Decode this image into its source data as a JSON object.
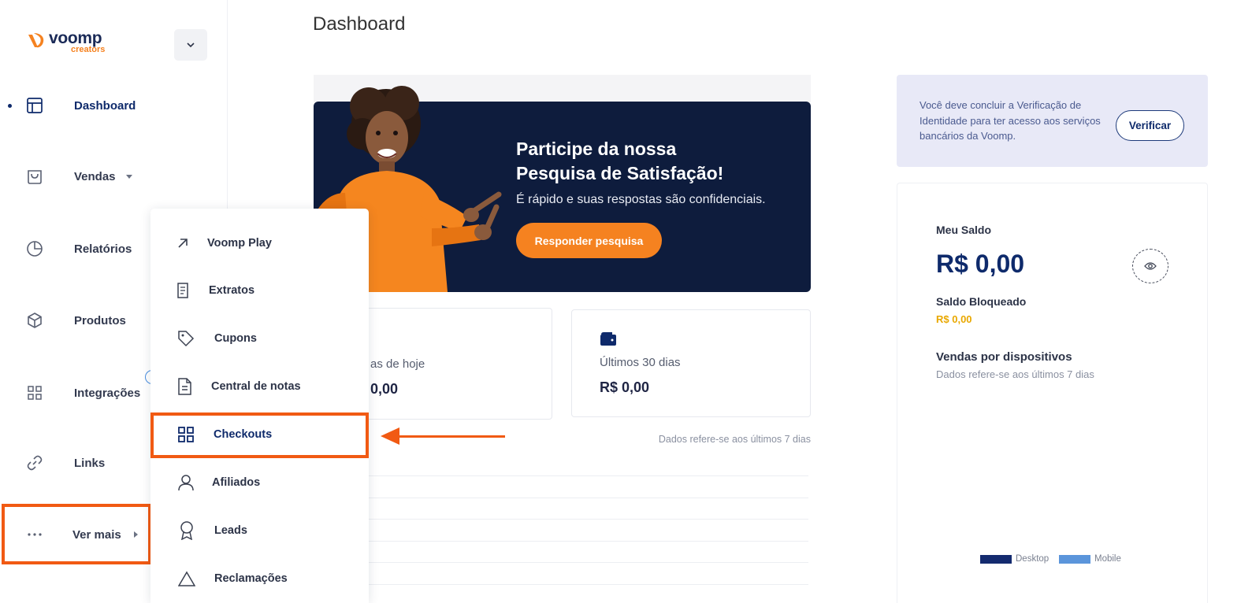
{
  "brand": {
    "name": "voomp",
    "sub": "creators",
    "orange": "#f58220",
    "navy": "#0e2a6b"
  },
  "sidebar": {
    "items": [
      {
        "label": "Dashboard",
        "icon": "layout-icon",
        "active": true
      },
      {
        "label": "Vendas",
        "icon": "shopping-bag-icon"
      },
      {
        "label": "Relatórios",
        "icon": "pie-chart-icon"
      },
      {
        "label": "Produtos",
        "icon": "box-icon"
      },
      {
        "label": "Integrações",
        "icon": "grid-icon"
      },
      {
        "label": "Links",
        "icon": "link-icon"
      },
      {
        "label": "Ver mais",
        "icon": "more-dots-icon"
      }
    ]
  },
  "dropdown": {
    "items": [
      {
        "label": "Voomp Play",
        "icon": "arrow-up-right-icon"
      },
      {
        "label": "Extratos",
        "icon": "document-icon"
      },
      {
        "label": "Cupons",
        "icon": "tag-icon"
      },
      {
        "label": "Central de notas",
        "icon": "file-text-icon"
      },
      {
        "label": "Checkouts",
        "icon": "grid-icon",
        "active": true
      },
      {
        "label": "Afiliados",
        "icon": "user-icon"
      },
      {
        "label": "Leads",
        "icon": "award-icon"
      },
      {
        "label": "Reclamações",
        "icon": "triangle-icon"
      }
    ]
  },
  "main": {
    "title": "Dashboard",
    "banner": {
      "title_line1": "Participe da nossa",
      "title_line2": "Pesquisa de Satisfação!",
      "subtitle": "É rápido e suas respostas são confidenciais.",
      "button": "Responder pesquisa"
    },
    "cards": [
      {
        "label": "as de hoje",
        "value": "0,00"
      },
      {
        "label": "Últimos 30 dias",
        "value": "R$ 0,00",
        "icon": "wallet-icon"
      }
    ],
    "chart_note": "Dados refere-se aos últimos 7 dias"
  },
  "right": {
    "verify_text": "Você deve concluir a Verificação de Identidade para ter acesso aos serviços bancários da Voomp.",
    "verify_button": "Verificar",
    "balance_label": "Meu Saldo",
    "balance_value": "R$ 0,00",
    "blocked_label": "Saldo Bloqueado",
    "blocked_value": "R$ 0,00",
    "devices_title": "Vendas por dispositivos",
    "devices_sub": "Dados refere-se aos últimos 7 dias",
    "legend": [
      {
        "label": "Desktop",
        "color": "#142b6f"
      },
      {
        "label": "Mobile",
        "color": "#5b95db"
      }
    ]
  }
}
